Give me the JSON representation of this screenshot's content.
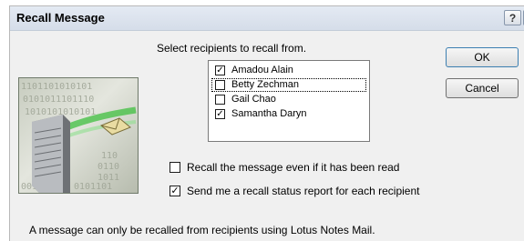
{
  "dialog": {
    "title": "Recall Message",
    "help_label": "?",
    "close_label": "✕"
  },
  "prompt": "Select recipients to recall from.",
  "recipients": [
    {
      "name": "Amadou Alain",
      "checked": true,
      "check_mark": "✓"
    },
    {
      "name": "Betty Zechman",
      "checked": false,
      "check_mark": ""
    },
    {
      "name": "Gail Chao",
      "checked": false,
      "check_mark": ""
    },
    {
      "name": "Samantha Daryn",
      "checked": true,
      "check_mark": "✓"
    }
  ],
  "buttons": {
    "ok": "OK",
    "cancel": "Cancel"
  },
  "options": {
    "recall_if_read": {
      "label": "Recall the message even if it has been read",
      "checked": false,
      "mark": ""
    },
    "status_report": {
      "label": "Send me a recall status report for each recipient",
      "checked": true,
      "mark": "✓"
    }
  },
  "footer_note": "A message can only be recalled from recipients using Lotus Notes Mail.",
  "illustration": {
    "binary_lines": [
      "1101101010101",
      "0101011101110",
      "1010101010101",
      "110",
      "0110",
      "1011",
      "0101101",
      "001101"
    ]
  }
}
